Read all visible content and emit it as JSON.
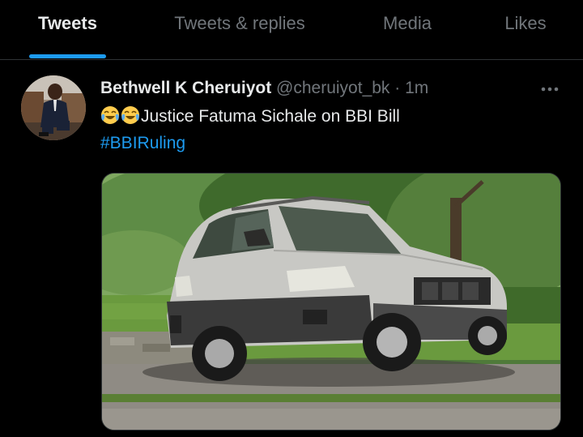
{
  "tabs": [
    {
      "label": "Tweets",
      "active": true
    },
    {
      "label": "Tweets & replies",
      "active": false
    },
    {
      "label": "Media",
      "active": false
    },
    {
      "label": "Likes",
      "active": false
    }
  ],
  "tweet": {
    "author_name": "Bethwell K Cheruiyot",
    "handle": "@cheruiyot_bk",
    "separator": "·",
    "time": "1m",
    "more_icon": "more-horizontal-icon",
    "text": "Justice Fatuma Sichale on BBI Bill",
    "emojis": [
      "face-with-tears-of-joy",
      "face-with-tears-of-joy"
    ],
    "hashtag": "#BBIRuling"
  },
  "colors": {
    "background": "#000000",
    "accent": "#1d9bf0",
    "text_primary": "#e7e9ea",
    "text_secondary": "#71767b",
    "divider": "#2f3336"
  }
}
